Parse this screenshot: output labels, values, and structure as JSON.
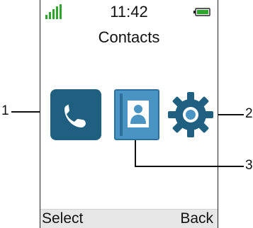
{
  "status": {
    "time": "11:42",
    "signal": "signal-bars-icon",
    "battery": "battery-icon"
  },
  "screen": {
    "title": "Contacts"
  },
  "menu_icons": [
    {
      "name": "calls",
      "icon": "phone-handset-icon",
      "color": "#1f5f7f"
    },
    {
      "name": "contacts",
      "icon": "contact-book-icon",
      "color": "#4a94c4"
    },
    {
      "name": "settings",
      "icon": "gear-icon",
      "color": "#1f5f7f"
    }
  ],
  "softkeys": {
    "left": "Select",
    "right": "Back"
  },
  "callouts": {
    "c1": "1",
    "c2": "2",
    "c3": "3"
  },
  "colors": {
    "signal": "#2fa52f",
    "battery": "#2fa52f",
    "softkey_bar": "#e6e6e6"
  }
}
